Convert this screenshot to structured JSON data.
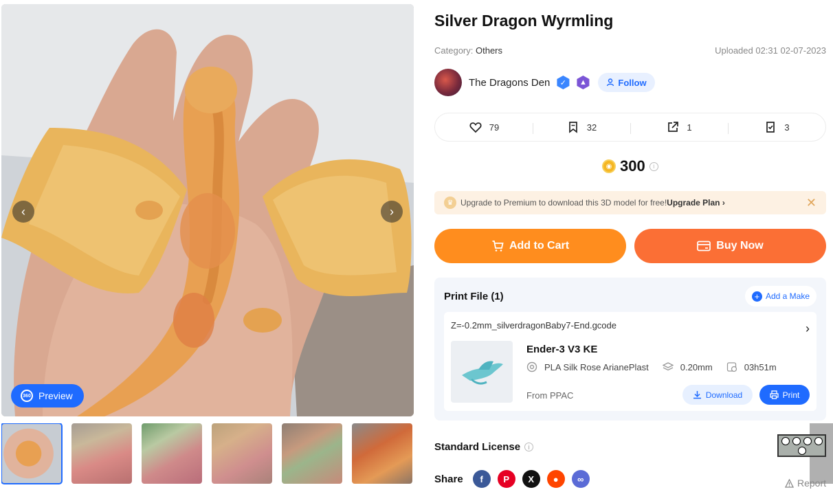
{
  "product": {
    "title": "Silver Dragon Wyrmling",
    "category_label": "Category:",
    "category_value": "Others",
    "uploaded": "Uploaded 02:31 02-07-2023"
  },
  "creator": {
    "name": "The Dragons Den",
    "follow_label": "Follow"
  },
  "stats": {
    "likes": "79",
    "collects": "32",
    "shares": "1",
    "makes": "3"
  },
  "price": {
    "value": "300"
  },
  "premium": {
    "text": "Upgrade to Premium to download this 3D model for free!",
    "link": "Upgrade Plan"
  },
  "actions": {
    "add_to_cart": "Add to Cart",
    "buy_now": "Buy Now"
  },
  "gallery": {
    "preview_label": "Preview",
    "thumbnail_count": 6
  },
  "print_file": {
    "title": "Print File (1)",
    "add_make": "Add a Make",
    "file_name": "Z=-0.2mm_silverdragonBaby7-End.gcode",
    "printer": "Ender-3 V3 KE",
    "filament": "PLA Silk Rose ArianePlast",
    "layer_height": "0.20mm",
    "print_time": "03h51m",
    "from": "From PPAC",
    "download": "Download",
    "print": "Print"
  },
  "license": {
    "label": "Standard License"
  },
  "share": {
    "label": "Share",
    "report": "Report"
  },
  "colors": {
    "primary": "#1f6bff",
    "cart": "#ff8d1e",
    "buy": "#fb6f35",
    "facebook": "#3b5998",
    "pinterest": "#e60023",
    "x": "#111111",
    "reddit": "#ff4500",
    "link": "#5b6bd6"
  },
  "icons": [
    "chevron-left-icon",
    "chevron-right-icon",
    "preview-360-icon",
    "heart-icon",
    "bookmark-icon",
    "share-out-icon",
    "makes-icon",
    "coin-icon",
    "info-icon",
    "crown-icon",
    "close-icon",
    "cart-icon",
    "card-icon",
    "plus-icon",
    "filament-icon",
    "layers-icon",
    "clock-icon",
    "download-icon",
    "printer-icon",
    "warning-icon"
  ]
}
